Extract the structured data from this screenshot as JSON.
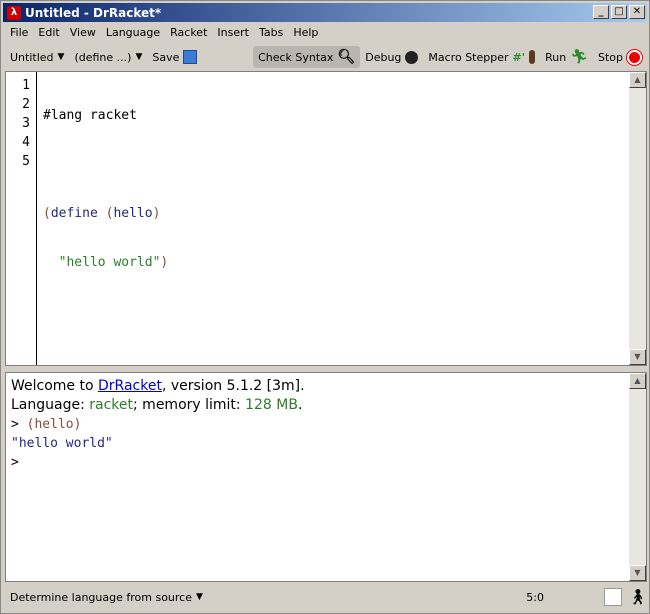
{
  "window": {
    "title": "Untitled - DrRacket*"
  },
  "menu": [
    "File",
    "Edit",
    "View",
    "Language",
    "Racket",
    "Insert",
    "Tabs",
    "Help"
  ],
  "toolbar": {
    "file_menu": "Untitled",
    "define_menu": "(define ...)",
    "save": "Save",
    "check_syntax": "Check Syntax",
    "debug": "Debug",
    "macro_stepper": "Macro Stepper",
    "macro_glyph": "#'",
    "run": "Run",
    "stop": "Stop"
  },
  "editor": {
    "line_numbers": [
      "1",
      "2",
      "3",
      "4",
      "5"
    ],
    "lines": {
      "l1": "#lang racket",
      "l3_open": "(",
      "l3_kw": "define",
      "l3_sp": " ",
      "l3_open2": "(",
      "l3_name": "hello",
      "l3_close": ")",
      "l4_indent": "  ",
      "l4_str": "\"hello world\"",
      "l4_close": ")"
    }
  },
  "interactions": {
    "welcome_pre": "Welcome to ",
    "welcome_link": "DrRacket",
    "welcome_post": ", version 5.1.2 [3m].",
    "lang_label": "Language: ",
    "lang_value": "racket",
    "lang_mid": "; memory limit: ",
    "mem_value": "128 MB",
    "lang_end": ".",
    "prompt": ">",
    "input": "(hello)",
    "output": "\"hello world\"",
    "prompt2": ">"
  },
  "status": {
    "language": "Determine language from source",
    "position": "5:0"
  }
}
